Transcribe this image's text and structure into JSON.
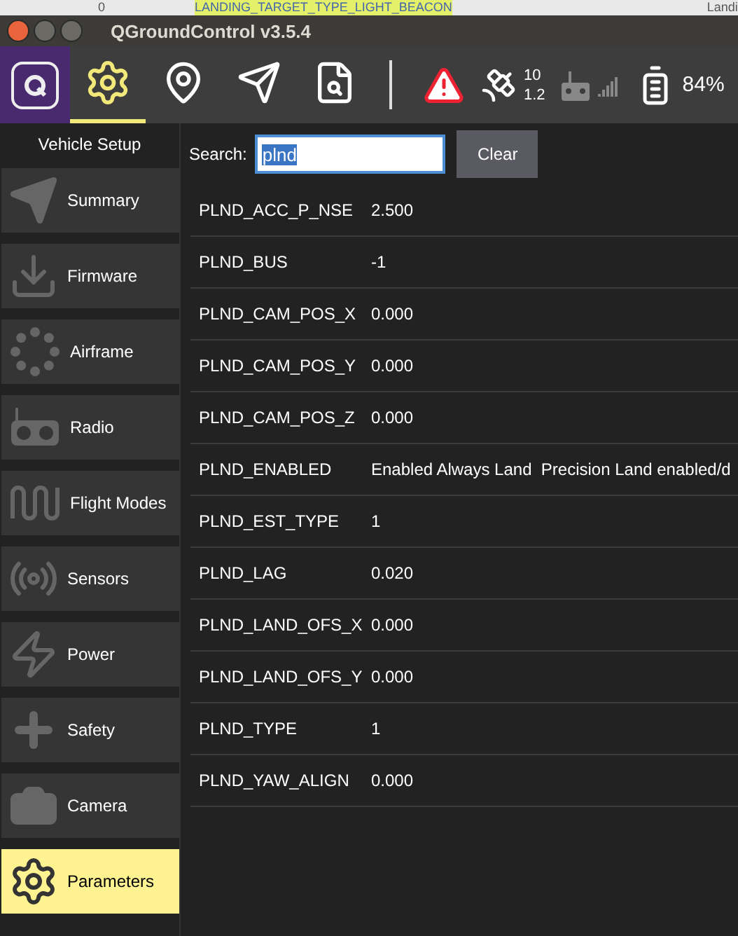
{
  "background_window": {
    "cells": [
      "0",
      "LANDING_TARGET_TYPE_LIGHT_BEACON",
      "Landi"
    ]
  },
  "window": {
    "title": "QGroundControl v3.5.4"
  },
  "toolbar": {
    "items": [
      {
        "kind": "logo",
        "selected": false
      },
      {
        "kind": "setup",
        "selected": true
      },
      {
        "kind": "plan",
        "selected": false
      },
      {
        "kind": "fly",
        "selected": false
      },
      {
        "kind": "analyze",
        "selected": false
      }
    ],
    "gps": {
      "satellites": "10",
      "hdop": "1.2"
    },
    "battery": "84%"
  },
  "sidebar": {
    "title": "Vehicle Setup",
    "items": [
      {
        "label": "Summary",
        "kind": "summary",
        "selected": false
      },
      {
        "label": "Firmware",
        "kind": "firmware",
        "selected": false
      },
      {
        "label": "Airframe",
        "kind": "airframe",
        "selected": false
      },
      {
        "label": "Radio",
        "kind": "radio",
        "selected": false
      },
      {
        "label": "Flight Modes",
        "kind": "modes",
        "selected": false
      },
      {
        "label": "Sensors",
        "kind": "sensors",
        "selected": false
      },
      {
        "label": "Power",
        "kind": "power",
        "selected": false
      },
      {
        "label": "Safety",
        "kind": "safety",
        "selected": false
      },
      {
        "label": "Camera",
        "kind": "camera",
        "selected": false
      },
      {
        "label": "Parameters",
        "kind": "parameters",
        "selected": true
      }
    ]
  },
  "search": {
    "label": "Search:",
    "value": "plnd",
    "button": "Clear"
  },
  "parameters": [
    {
      "name": "PLND_ACC_P_NSE",
      "value": "2.500"
    },
    {
      "name": "PLND_BUS",
      "value": "-1"
    },
    {
      "name": "PLND_CAM_POS_X",
      "value": "0.000"
    },
    {
      "name": "PLND_CAM_POS_Y",
      "value": "0.000"
    },
    {
      "name": "PLND_CAM_POS_Z",
      "value": "0.000"
    },
    {
      "name": "PLND_ENABLED",
      "value": "Enabled Always Land  Precision Land enabled/d"
    },
    {
      "name": "PLND_EST_TYPE",
      "value": "1"
    },
    {
      "name": "PLND_LAG",
      "value": "0.020"
    },
    {
      "name": "PLND_LAND_OFS_X",
      "value": "0.000"
    },
    {
      "name": "PLND_LAND_OFS_Y",
      "value": "0.000"
    },
    {
      "name": "PLND_TYPE",
      "value": "1"
    },
    {
      "name": "PLND_YAW_ALIGN",
      "value": "0.000"
    }
  ]
}
